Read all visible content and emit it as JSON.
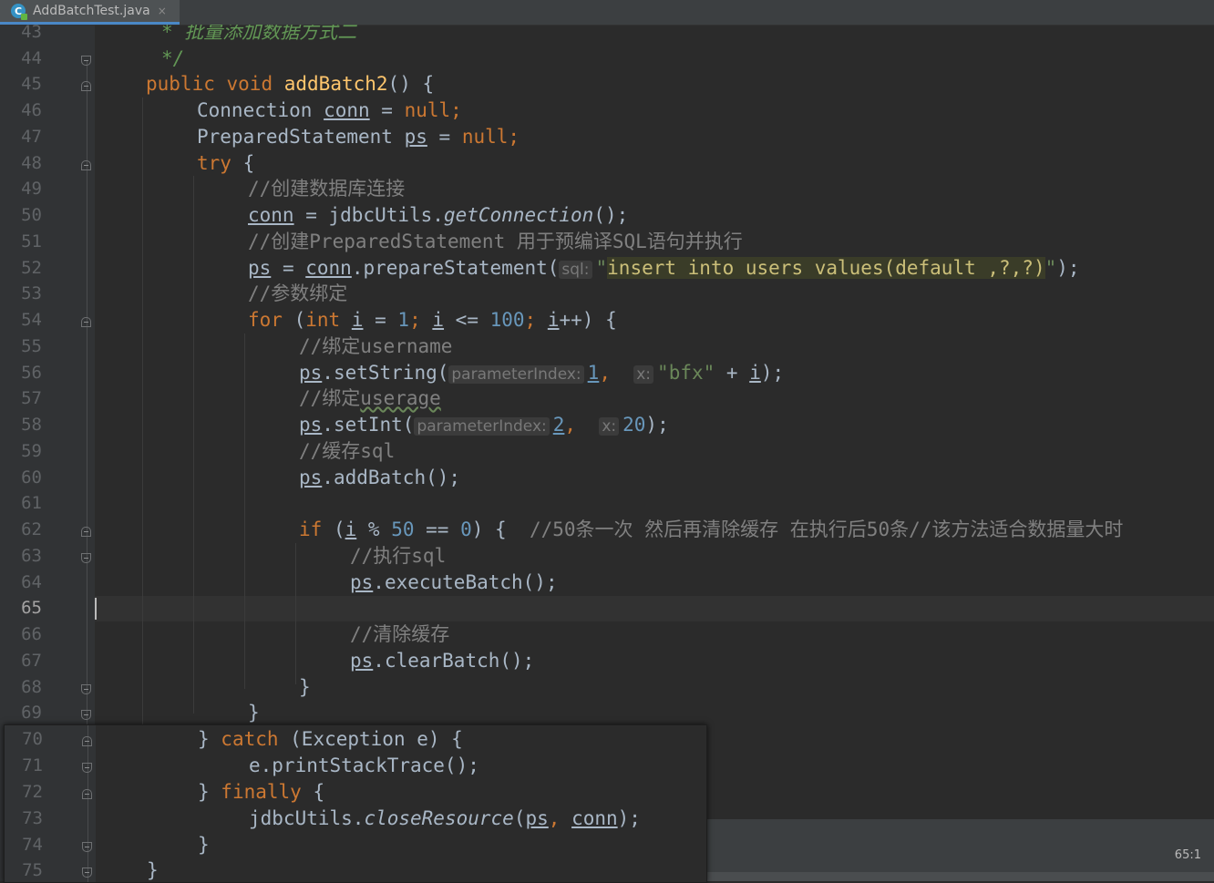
{
  "tab": {
    "icon": "java-class-icon",
    "label": "AddBatchTest.java",
    "close": "×"
  },
  "line_numbers": [
    "43",
    "44",
    "45",
    "46",
    "47",
    "48",
    "49",
    "50",
    "51",
    "52",
    "53",
    "54",
    "55",
    "56",
    "57",
    "58",
    "59",
    "60",
    "61",
    "62",
    "63",
    "64",
    "65",
    "66",
    "67",
    "68",
    "69",
    "70",
    "71",
    "72",
    "73",
    "74",
    "75"
  ],
  "current_line": "65",
  "code": {
    "l43": "* 批量添加数据方式二",
    "l44": "*/",
    "l45": [
      "public",
      " ",
      "void",
      " ",
      "addBatch2",
      "() {"
    ],
    "l46": [
      "Connection ",
      "conn",
      " = ",
      "null",
      ";"
    ],
    "l47": [
      "PreparedStatement ",
      "ps",
      " = ",
      "null",
      ";"
    ],
    "l48": [
      "try",
      " {"
    ],
    "l49": "//创建数据库连接",
    "l50": [
      "conn",
      " = jdbcUtils.",
      "getConnection",
      "();"
    ],
    "l51": "//创建PreparedStatement 用于预编译SQL语句并执行",
    "l52": [
      "ps",
      " = ",
      "conn",
      ".prepareStatement(",
      "sql:",
      "\"",
      "insert into users values(default ,?,?)",
      "\"",
      ");"
    ],
    "l53": "//参数绑定",
    "l54": [
      "for",
      " (",
      "int",
      " ",
      "i",
      " = ",
      "1",
      "; ",
      "i",
      " <= ",
      "100",
      "; ",
      "i",
      "++) {"
    ],
    "l55": "//绑定username",
    "l56": [
      "ps",
      ".setString(",
      "parameterIndex:",
      "1",
      ",  ",
      "x:",
      "\"bfx\"",
      " + ",
      "i",
      ");"
    ],
    "l57_prefix": "//绑定",
    "l57_word": "userage",
    "l58": [
      "ps",
      ".setInt(",
      "parameterIndex:",
      "2",
      ",  ",
      "x:",
      "20",
      ");"
    ],
    "l59": "//缓存sql",
    "l60": [
      "ps",
      ".addBatch();"
    ],
    "l62": [
      "if",
      " (",
      "i",
      " % ",
      "50",
      " == ",
      "0",
      ") {  ",
      "//50条一次 然后再清除缓存 在执行后50条//该方法适合数据量大时"
    ],
    "l63": "//执行sql",
    "l64": [
      "ps",
      ".executeBatch();"
    ],
    "l66": "//清除缓存",
    "l67": [
      "ps",
      ".clearBatch();"
    ],
    "l68": "}",
    "l69": "}",
    "l70": [
      "} ",
      "catch",
      " (Exception e) {"
    ],
    "l71": "e.printStackTrace();",
    "l72": [
      "} ",
      "finally",
      " {"
    ],
    "l73": [
      "jdbcUtils.",
      "closeResource",
      "(",
      "ps",
      ", ",
      "conn",
      ");"
    ],
    "l74": "}",
    "l75": "}"
  },
  "status": {
    "caret_position": "65:1"
  },
  "colors": {
    "background": "#2b2b2b",
    "gutter": "#313335",
    "keyword": "#cc7832",
    "method": "#ffc66d",
    "number": "#6897bb",
    "string": "#6a8759",
    "comment": "#808080",
    "text": "#a9b7c6"
  }
}
